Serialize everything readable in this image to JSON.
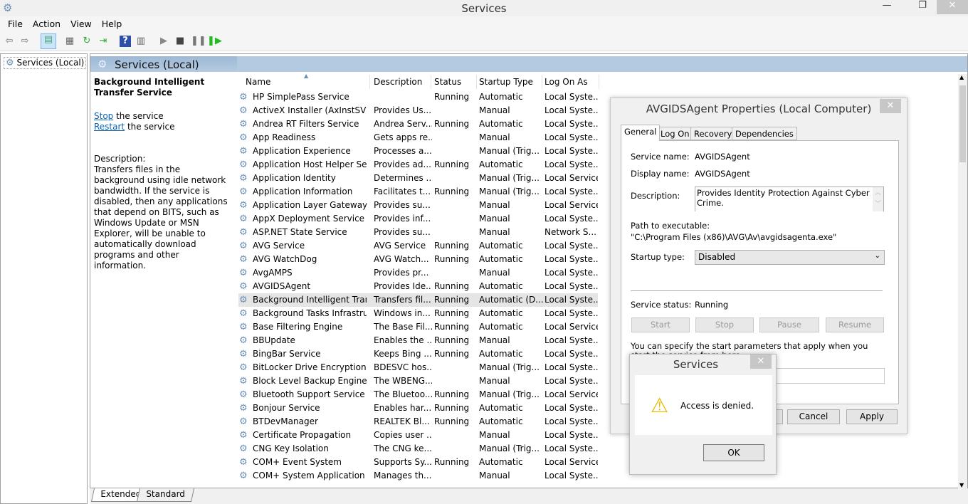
{
  "window": {
    "title": "Services",
    "minimize": "—",
    "restore": "❐",
    "close": "✕"
  },
  "menu": [
    "File",
    "Action",
    "View",
    "Help"
  ],
  "toolbar": {
    "icons": [
      "back-icon",
      "forward-icon",
      "show-hide-tree-icon",
      "properties-icon",
      "refresh-icon",
      "export-icon",
      "help-icon",
      "console-icon",
      "start-service-icon",
      "stop-service-icon",
      "pause-service-icon",
      "resume-service-icon"
    ]
  },
  "tree": {
    "root": "Services (Local)"
  },
  "header": {
    "title": "Services (Local)"
  },
  "details": {
    "service_title": "Background Intelligent Transfer Service",
    "stop_link": "Stop",
    "stop_suffix": " the service",
    "restart_link": "Restart",
    "restart_suffix": " the service",
    "description_label": "Description:",
    "description": "Transfers files in the background using idle network bandwidth. If the service is disabled, then any applications that depend on BITS, such as Windows Update or MSN Explorer, will be unable to automatically download programs and other information."
  },
  "columns": [
    "Name",
    "Description",
    "Status",
    "Startup Type",
    "Log On As"
  ],
  "rows": [
    [
      "HP SimplePass Service",
      "",
      "Running",
      "Automatic",
      "Local Syste..."
    ],
    [
      "ActiveX Installer (AxInstSV)",
      "Provides Us...",
      "",
      "Manual",
      "Local Syste..."
    ],
    [
      "Andrea RT Filters Service",
      "Andrea Serv...",
      "Running",
      "Automatic",
      "Local Syste..."
    ],
    [
      "App Readiness",
      "Gets apps re...",
      "",
      "Manual",
      "Local Syste..."
    ],
    [
      "Application Experience",
      "Processes a...",
      "",
      "Manual (Trig...",
      "Local Syste..."
    ],
    [
      "Application Host Helper Ser...",
      "Provides ad...",
      "Running",
      "Automatic",
      "Local Syste..."
    ],
    [
      "Application Identity",
      "Determines ...",
      "",
      "Manual (Trig...",
      "Local Service"
    ],
    [
      "Application Information",
      "Facilitates t...",
      "Running",
      "Manual (Trig...",
      "Local Syste..."
    ],
    [
      "Application Layer Gateway ...",
      "Provides su...",
      "",
      "Manual",
      "Local Service"
    ],
    [
      "AppX Deployment Service (...",
      "Provides inf...",
      "",
      "Manual",
      "Local Syste..."
    ],
    [
      "ASP.NET State Service",
      "Provides su...",
      "",
      "Manual",
      "Network S..."
    ],
    [
      "AVG Service",
      "AVG Service",
      "Running",
      "Automatic",
      "Local Syste..."
    ],
    [
      "AVG WatchDog",
      "AVG Watch...",
      "Running",
      "Automatic",
      "Local Syste..."
    ],
    [
      "AvgAMPS",
      "Provides pr...",
      "",
      "Manual",
      "Local Syste..."
    ],
    [
      "AVGIDSAgent",
      "Provides Ide...",
      "Running",
      "Automatic",
      "Local Syste..."
    ],
    [
      "Background Intelligent Tran...",
      "Transfers fil...",
      "Running",
      "Automatic (D...",
      "Local Syste..."
    ],
    [
      "Background Tasks Infrastru...",
      "Windows in...",
      "Running",
      "Automatic",
      "Local Syste..."
    ],
    [
      "Base Filtering Engine",
      "The Base Fil...",
      "Running",
      "Automatic",
      "Local Service"
    ],
    [
      "BBUpdate",
      "Enables the ...",
      "Running",
      "Manual",
      "Local Syste..."
    ],
    [
      "BingBar Service",
      "Keeps Bing ...",
      "Running",
      "Automatic",
      "Local Syste..."
    ],
    [
      "BitLocker Drive Encryption ...",
      "BDESVC hos...",
      "",
      "Manual (Trig...",
      "Local Syste..."
    ],
    [
      "Block Level Backup Engine ...",
      "The WBENG...",
      "",
      "Manual",
      "Local Syste..."
    ],
    [
      "Bluetooth Support Service",
      "The Bluetoo...",
      "Running",
      "Manual (Trig...",
      "Local Service"
    ],
    [
      "Bonjour Service",
      "Enables har...",
      "Running",
      "Automatic",
      "Local Syste..."
    ],
    [
      "BTDevManager",
      "REALTEK Bl...",
      "Running",
      "Automatic",
      "Local Syste..."
    ],
    [
      "Certificate Propagation",
      "Copies user ...",
      "",
      "Manual",
      "Local Syste..."
    ],
    [
      "CNG Key Isolation",
      "The CNG ke...",
      "",
      "Manual (Trig...",
      "Local Syste..."
    ],
    [
      "COM+ Event System",
      "Supports Sy...",
      "Running",
      "Automatic",
      "Local Service"
    ],
    [
      "COM+ System Application",
      "Manages th...",
      "",
      "Manual",
      "Local Syste..."
    ]
  ],
  "selected_row": 15,
  "bottom_tabs": [
    "Extended",
    "Standard"
  ],
  "properties": {
    "title": "AVGIDSAgent Properties (Local Computer)",
    "tabs": [
      "General",
      "Log On",
      "Recovery",
      "Dependencies"
    ],
    "service_name_label": "Service name:",
    "service_name": "AVGIDSAgent",
    "display_name_label": "Display name:",
    "display_name": "AVGIDSAgent",
    "description_label": "Description:",
    "description": "Provides Identity Protection Against Cyber Crime.",
    "path_label": "Path to executable:",
    "path": "\"C:\\Program Files (x86)\\AVG\\Av\\avgidsagenta.exe\"",
    "startup_label": "Startup type:",
    "startup_value": "Disabled",
    "status_label": "Service status:",
    "status": "Running",
    "buttons": [
      "Start",
      "Stop",
      "Pause",
      "Resume"
    ],
    "params_text": "You can specify the start parameters that apply when you start the service from here.",
    "cancel": "Cancel",
    "apply": "Apply"
  },
  "message": {
    "title": "Services",
    "text": "Access is denied.",
    "ok": "OK"
  }
}
